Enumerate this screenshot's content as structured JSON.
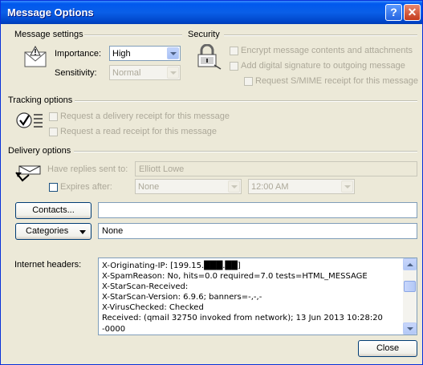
{
  "window": {
    "title": "Message Options",
    "help_glyph": "?",
    "close_glyph": "✕"
  },
  "message_settings": {
    "group_label": "Message settings",
    "importance_label": "Importance:",
    "importance_value": "High",
    "sensitivity_label": "Sensitivity:",
    "sensitivity_value": "Normal"
  },
  "security": {
    "group_label": "Security",
    "encrypt_label": "Encrypt message contents and attachments",
    "signature_label": "Add digital signature to outgoing message",
    "smime_label": "Request S/MIME receipt for this message"
  },
  "tracking": {
    "group_label": "Tracking options",
    "delivery_receipt_label": "Request a delivery receipt for this message",
    "read_receipt_label": "Request a read receipt for this message"
  },
  "delivery": {
    "group_label": "Delivery options",
    "replies_label": "Have replies sent to:",
    "replies_value": "Elliott Lowe",
    "expires_label": "Expires after:",
    "expires_date": "None",
    "expires_time": "12:00 AM"
  },
  "contacts": {
    "button_label": "Contacts...",
    "value": ""
  },
  "categories": {
    "button_label": "Categories",
    "value": "None"
  },
  "headers": {
    "label": "Internet headers:",
    "text": "X-Originating-IP: [199.15.███.██]\nX-SpamReason: No, hits=0.0 required=7.0 tests=HTML_MESSAGE\nX-StarScan-Received:\nX-StarScan-Version: 6.9.6; banners=-,-,-\nX-VirusChecked: Checked\nReceived: (qmail 32750 invoked from network); 13 Jun 2013 10:28:20\n-0000"
  },
  "footer": {
    "close_label": "Close"
  },
  "colors": {
    "titlebar": "#0058EE",
    "dialog": "#ECE9D8",
    "disabled_text": "#ACA899"
  }
}
